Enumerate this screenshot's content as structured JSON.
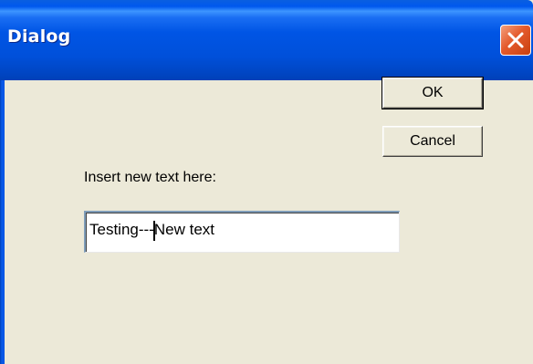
{
  "window": {
    "title": "Dialog"
  },
  "buttons": {
    "ok_label": "OK",
    "cancel_label": "Cancel"
  },
  "form": {
    "prompt_label": "Insert new text here:",
    "text_value_before_caret": "Testing---",
    "text_value_after_caret": "New text"
  },
  "icons": {
    "close": "close-icon"
  },
  "colors": {
    "titlebar": "#0055e5",
    "close_button": "#e45a2c",
    "dialog_background": "#ece9d8"
  }
}
